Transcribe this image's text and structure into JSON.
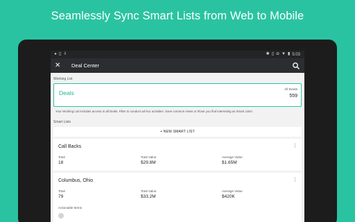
{
  "headline": "Seamlessly Sync Smart Lists from Web to Mobile",
  "colors": {
    "brand": "#2ac3a2",
    "link": "#21b495",
    "appbar": "#2b2d30"
  },
  "statusbar": {
    "left_icons": [
      "notification-icon",
      "phone-icon",
      "download-icon"
    ],
    "time": "5:03",
    "right_icons": [
      "bluetooth-icon",
      "vibrate-icon",
      "dnd-icon",
      "wifi-icon",
      "battery-icon"
    ]
  },
  "appbar": {
    "close_icon": "close-icon",
    "title": "Deal Center",
    "search_icon": "search-icon"
  },
  "working_list": {
    "section_label": "Working List",
    "title": "Deals",
    "count_label": "All Deals",
    "count": "559",
    "description": "Your Working List includes access to all Deals. Filter to conduct ad-hoc activities. Save common views or those you find interesting as Smart Lists!"
  },
  "smart_lists": {
    "section_label": "Smart Lists",
    "new_button": "+ NEW SMART LIST",
    "items": [
      {
        "title": "Call Backs",
        "metrics": [
          {
            "label": "Total",
            "value": "18"
          },
          {
            "label": "Total Value",
            "value": "$29.8M"
          },
          {
            "label": "Average Value",
            "value": "$1.65M"
          }
        ]
      },
      {
        "title": "Columbus, Ohio",
        "metrics": [
          {
            "label": "Total",
            "value": "79"
          },
          {
            "label": "Total Value",
            "value": "$33.2M"
          },
          {
            "label": "Average Value",
            "value": "$420K"
          }
        ],
        "actionable_label": "Actionable Items"
      }
    ]
  }
}
